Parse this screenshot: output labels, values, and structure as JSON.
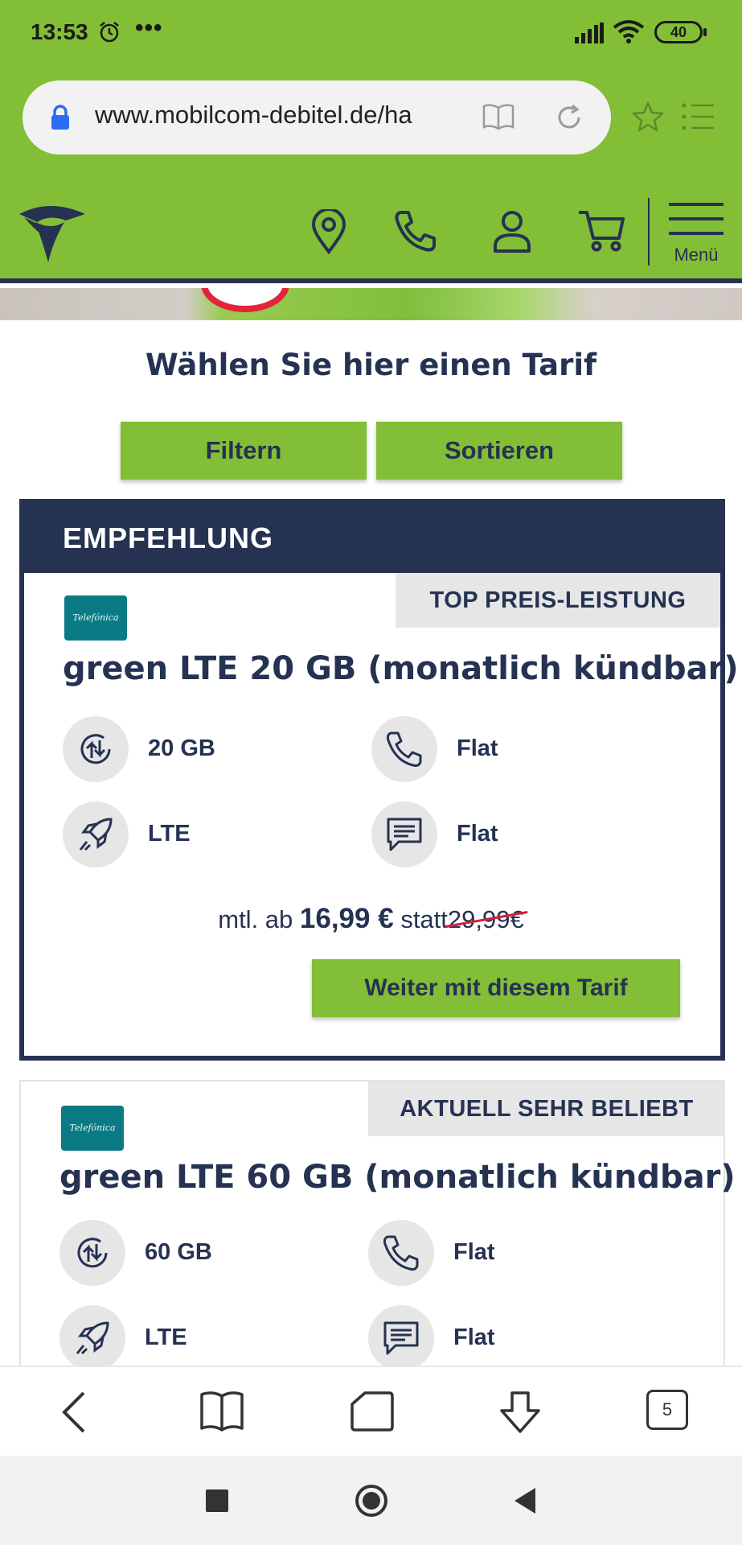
{
  "status_bar": {
    "time": "13:53",
    "more": "•••",
    "battery": "40"
  },
  "browser": {
    "url": "www.mobilcom-debitel.de/ha"
  },
  "header": {
    "menu_label": "Menü"
  },
  "page": {
    "title": "Wählen Sie hier einen Tarif",
    "filter_label": "Filtern",
    "sort_label": "Sortieren"
  },
  "tariffs": [
    {
      "banner": "EMPFEHLUNG",
      "ribbon": "TOP PREIS-LEISTUNG",
      "provider_logo": "Telefónica",
      "name": "green LTE 20 GB (monatlich kündbar)",
      "data": "20 GB",
      "calls": "Flat",
      "network": "LTE",
      "sms": "Flat",
      "price_prefix": "mtl. ab",
      "price": "16,99 €",
      "price_instead": "statt",
      "price_old": "29,99€",
      "cta": "Weiter mit diesem Tarif"
    },
    {
      "ribbon": "AKTUELL SEHR BELIEBT",
      "provider_logo": "Telefónica",
      "name": "green LTE 60 GB (monatlich kündbar)",
      "data": "60 GB",
      "calls": "Flat",
      "network": "LTE",
      "sms": "Flat"
    }
  ],
  "bottom_nav": {
    "tab_count": "5"
  },
  "colors": {
    "brand_green": "#83be37",
    "navy": "#253252",
    "strike_red": "#d6203a",
    "telefonica_teal": "#0a7b84"
  }
}
